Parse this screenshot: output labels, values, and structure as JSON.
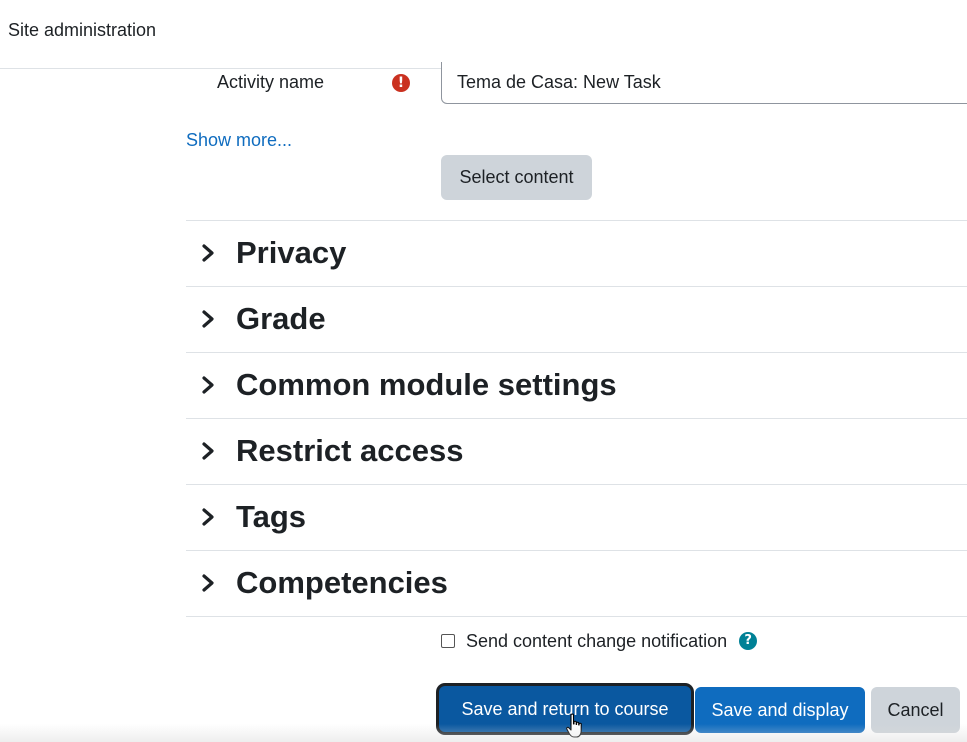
{
  "topbar": {
    "site_admin": "Site administration"
  },
  "activity": {
    "label": "Activity name",
    "required_icon": "exclamation-circle-icon",
    "value": "Tema de Casa: New Task"
  },
  "show_more": "Show more...",
  "select_content": "Select content",
  "sections": [
    {
      "title": "Privacy"
    },
    {
      "title": "Grade"
    },
    {
      "title": "Common module settings"
    },
    {
      "title": "Restrict access"
    },
    {
      "title": "Tags"
    },
    {
      "title": "Competencies"
    }
  ],
  "notification": {
    "label": "Send content change notification",
    "checked": false,
    "help_icon": "question-circle-icon"
  },
  "buttons": {
    "save_return": "Save and return to course",
    "save_display": "Save and display",
    "cancel": "Cancel"
  },
  "colors": {
    "primary": "#0f6cbf",
    "primary_focused": "#0a58a0",
    "secondary": "#ced4da",
    "required": "#ca3120",
    "help": "#008196"
  }
}
